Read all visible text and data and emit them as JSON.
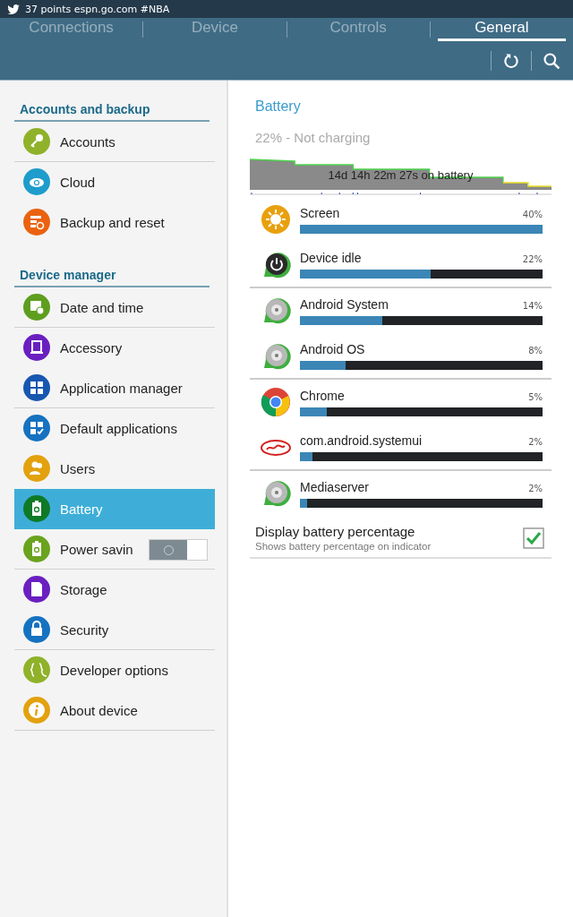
{
  "status_bar": {
    "notification": "37 points espn.go.com #NBA"
  },
  "tabs": [
    {
      "label": "Connections",
      "selected": false
    },
    {
      "label": "Device",
      "selected": false
    },
    {
      "label": "Controls",
      "selected": false
    },
    {
      "label": "General",
      "selected": true
    }
  ],
  "sidebar": {
    "sections": [
      {
        "title": "Accounts and backup",
        "items": [
          {
            "label": "Accounts",
            "color": "#8fb22a",
            "selected": false,
            "divider_below": true
          },
          {
            "label": "Cloud",
            "color": "#1e9ccb",
            "selected": false,
            "divider_below": false
          },
          {
            "label": "Backup and reset",
            "color": "#ea6210",
            "selected": false,
            "divider_below": false
          }
        ]
      },
      {
        "title": "Device manager",
        "items": [
          {
            "label": "Date and time",
            "color": "#5e9e1f",
            "selected": false,
            "divider_below": true
          },
          {
            "label": "Accessory",
            "color": "#6a1fc0",
            "selected": false,
            "divider_below": false
          },
          {
            "label": "Application manager",
            "color": "#1857b0",
            "selected": false,
            "divider_below": true
          },
          {
            "label": "Default applications",
            "color": "#1572c0",
            "selected": false,
            "divider_below": false
          },
          {
            "label": "Users",
            "color": "#e3a10e",
            "selected": false,
            "divider_below": false
          },
          {
            "label": "Battery",
            "color": "#0f7a26",
            "selected": true,
            "divider_below": false
          },
          {
            "label": "Power savin",
            "color": "#6aa31e",
            "selected": false,
            "divider_below": true,
            "kind": "toggle",
            "on": false
          },
          {
            "label": "Storage",
            "color": "#6a1fc0",
            "selected": false,
            "divider_below": false
          },
          {
            "label": "Security",
            "color": "#1572c0",
            "selected": false,
            "divider_below": true
          },
          {
            "label": "Developer options",
            "color": "#8fb22a",
            "selected": false,
            "divider_below": false
          },
          {
            "label": "About device",
            "color": "#e3a10e",
            "selected": false,
            "divider_below": true
          }
        ]
      }
    ]
  },
  "battery": {
    "title": "Battery",
    "status": "22% - Not charging",
    "graph_caption": "14d 14h 22m 27s on battery",
    "usage": [
      {
        "name": "Screen",
        "percent": "40%",
        "level": 1.0,
        "divider_below": false
      },
      {
        "name": "Device idle",
        "percent": "22%",
        "level": 0.54,
        "divider_below": true
      },
      {
        "name": "Android System",
        "percent": "14%",
        "level": 0.34,
        "divider_below": false
      },
      {
        "name": "Android OS",
        "percent": "8%",
        "level": 0.19,
        "divider_below": true
      },
      {
        "name": "Chrome",
        "percent": "5%",
        "level": 0.11,
        "divider_below": false
      },
      {
        "name": "com.android.systemui",
        "percent": "2%",
        "level": 0.05,
        "divider_below": true
      },
      {
        "name": "Mediaserver",
        "percent": "2%",
        "level": 0.03,
        "divider_below": false
      }
    ],
    "display_percentage": {
      "label": "Display battery percentage",
      "summary": "Shows battery percentage on indicator",
      "checked": true
    }
  }
}
